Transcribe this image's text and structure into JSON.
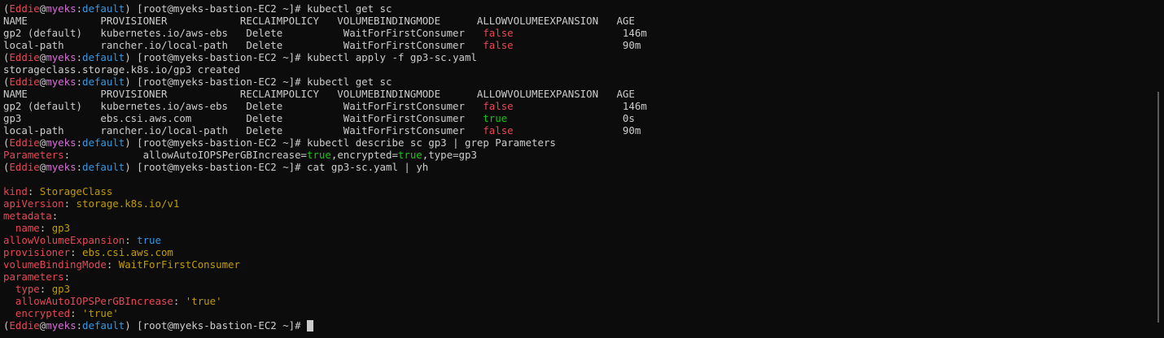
{
  "terminal": {
    "colors": {
      "background": "#0c0c0c",
      "foreground": "#cccccc",
      "red": "#e74856",
      "magenta": "#d670d6",
      "cyan": "#3a96dd",
      "green": "#16c60c",
      "yellow": "#c19c00"
    },
    "lines": [
      {
        "segs": [
          [
            "(",
            "gray"
          ],
          [
            "Eddie",
            "red"
          ],
          [
            "@",
            "gray"
          ],
          [
            "myeks",
            "mag"
          ],
          [
            ":",
            "gray"
          ],
          [
            "default",
            "cyan"
          ],
          [
            ") [root@myeks-bastion-EC2 ~]# kubectl get sc",
            "gray"
          ]
        ]
      },
      {
        "segs": [
          [
            "NAME            PROVISIONER            RECLAIMPOLICY   VOLUMEBINDINGMODE      ALLOWVOLUMEEXPANSION   AGE",
            "gray"
          ]
        ]
      },
      {
        "segs": [
          [
            "gp2 (default)   kubernetes.io/aws-ebs   Delete          WaitForFirstConsumer   ",
            "gray"
          ],
          [
            "false",
            "red"
          ],
          [
            "                  146m",
            "gray"
          ]
        ]
      },
      {
        "segs": [
          [
            "local-path      rancher.io/local-path   Delete          WaitForFirstConsumer   ",
            "gray"
          ],
          [
            "false",
            "red"
          ],
          [
            "                  90m",
            "gray"
          ]
        ]
      },
      {
        "segs": [
          [
            "(",
            "gray"
          ],
          [
            "Eddie",
            "red"
          ],
          [
            "@",
            "gray"
          ],
          [
            "myeks",
            "mag"
          ],
          [
            ":",
            "gray"
          ],
          [
            "default",
            "cyan"
          ],
          [
            ") [root@myeks-bastion-EC2 ~]# kubectl apply -f gp3-sc.yaml",
            "gray"
          ]
        ]
      },
      {
        "segs": [
          [
            "storageclass.storage.k8s.io/gp3 created",
            "gray"
          ]
        ]
      },
      {
        "segs": [
          [
            "(",
            "gray"
          ],
          [
            "Eddie",
            "red"
          ],
          [
            "@",
            "gray"
          ],
          [
            "myeks",
            "mag"
          ],
          [
            ":",
            "gray"
          ],
          [
            "default",
            "cyan"
          ],
          [
            ") [root@myeks-bastion-EC2 ~]# kubectl get sc",
            "gray"
          ]
        ]
      },
      {
        "segs": [
          [
            "NAME            PROVISIONER            RECLAIMPOLICY   VOLUMEBINDINGMODE      ALLOWVOLUMEEXPANSION   AGE",
            "gray"
          ]
        ]
      },
      {
        "segs": [
          [
            "gp2 (default)   kubernetes.io/aws-ebs   Delete          WaitForFirstConsumer   ",
            "gray"
          ],
          [
            "false",
            "red"
          ],
          [
            "                  146m",
            "gray"
          ]
        ]
      },
      {
        "segs": [
          [
            "gp3             ebs.csi.aws.com         Delete          WaitForFirstConsumer   ",
            "gray"
          ],
          [
            "true",
            "green"
          ],
          [
            "                   0s",
            "gray"
          ]
        ]
      },
      {
        "segs": [
          [
            "local-path      rancher.io/local-path   Delete          WaitForFirstConsumer   ",
            "gray"
          ],
          [
            "false",
            "red"
          ],
          [
            "                  90m",
            "gray"
          ]
        ]
      },
      {
        "segs": [
          [
            "(",
            "gray"
          ],
          [
            "Eddie",
            "red"
          ],
          [
            "@",
            "gray"
          ],
          [
            "myeks",
            "mag"
          ],
          [
            ":",
            "gray"
          ],
          [
            "default",
            "cyan"
          ],
          [
            ") [root@myeks-bastion-EC2 ~]# kubectl describe sc gp3 | grep Parameters",
            "gray"
          ]
        ]
      },
      {
        "segs": [
          [
            "Parameters",
            "red"
          ],
          [
            ":            allowAutoIOPSPerGBIncrease=",
            "gray"
          ],
          [
            "true",
            "green"
          ],
          [
            ",encrypted=",
            "gray"
          ],
          [
            "true",
            "green"
          ],
          [
            ",type=gp3",
            "gray"
          ]
        ]
      },
      {
        "segs": [
          [
            "(",
            "gray"
          ],
          [
            "Eddie",
            "red"
          ],
          [
            "@",
            "gray"
          ],
          [
            "myeks",
            "mag"
          ],
          [
            ":",
            "gray"
          ],
          [
            "default",
            "cyan"
          ],
          [
            ") [root@myeks-bastion-EC2 ~]# cat gp3-sc.yaml | yh",
            "gray"
          ]
        ]
      },
      {
        "segs": [
          [
            "",
            "gray"
          ]
        ]
      },
      {
        "segs": [
          [
            "kind",
            "red"
          ],
          [
            ": ",
            "gray"
          ],
          [
            "StorageClass",
            "yellow"
          ]
        ]
      },
      {
        "segs": [
          [
            "apiVersion",
            "red"
          ],
          [
            ": ",
            "gray"
          ],
          [
            "storage.k8s.io/v1",
            "yellow"
          ]
        ]
      },
      {
        "segs": [
          [
            "metadata",
            "red"
          ],
          [
            ":",
            "gray"
          ]
        ]
      },
      {
        "segs": [
          [
            "  name",
            "red"
          ],
          [
            ": ",
            "gray"
          ],
          [
            "gp3",
            "yellow"
          ]
        ]
      },
      {
        "segs": [
          [
            "allowVolumeExpansion",
            "red"
          ],
          [
            ": ",
            "gray"
          ],
          [
            "true",
            "cyan"
          ]
        ]
      },
      {
        "segs": [
          [
            "provisioner",
            "red"
          ],
          [
            ": ",
            "gray"
          ],
          [
            "ebs.csi.aws.com",
            "yellow"
          ]
        ]
      },
      {
        "segs": [
          [
            "volumeBindingMode",
            "red"
          ],
          [
            ": ",
            "gray"
          ],
          [
            "WaitForFirstConsumer",
            "yellow"
          ]
        ]
      },
      {
        "segs": [
          [
            "parameters",
            "red"
          ],
          [
            ":",
            "gray"
          ]
        ]
      },
      {
        "segs": [
          [
            "  type",
            "red"
          ],
          [
            ": ",
            "gray"
          ],
          [
            "gp3",
            "yellow"
          ]
        ]
      },
      {
        "segs": [
          [
            "  allowAutoIOPSPerGBIncrease",
            "red"
          ],
          [
            ": ",
            "gray"
          ],
          [
            "'true'",
            "yellow"
          ]
        ]
      },
      {
        "segs": [
          [
            "  encrypted",
            "red"
          ],
          [
            ": ",
            "gray"
          ],
          [
            "'true'",
            "yellow"
          ]
        ]
      },
      {
        "segs": [
          [
            "(",
            "gray"
          ],
          [
            "Eddie",
            "red"
          ],
          [
            "@",
            "gray"
          ],
          [
            "myeks",
            "mag"
          ],
          [
            ":",
            "gray"
          ],
          [
            "default",
            "cyan"
          ],
          [
            ") [root@myeks-bastion-EC2 ~]# ",
            "gray"
          ]
        ],
        "cursor": true
      }
    ]
  }
}
